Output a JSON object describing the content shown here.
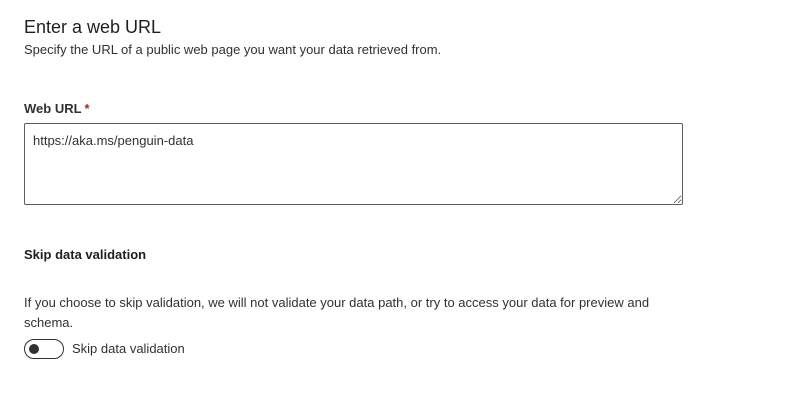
{
  "header": {
    "title": "Enter a web URL",
    "subtitle": "Specify the URL of a public web page you want your data retrieved from."
  },
  "web_url": {
    "label": "Web URL",
    "required_mark": "*",
    "value": "https://aka.ms/penguin-data"
  },
  "skip_validation": {
    "heading": "Skip data validation",
    "description": "If you choose to skip validation, we will not validate your data path, or try to access your data for preview and schema.",
    "toggle_label": "Skip data validation",
    "toggle_checked": false
  }
}
